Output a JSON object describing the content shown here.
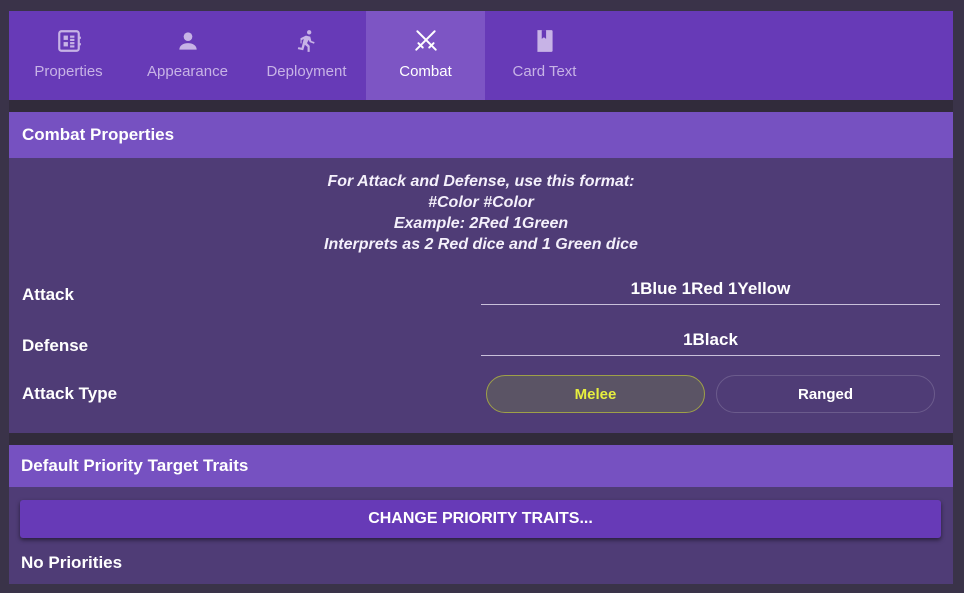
{
  "tabs": [
    {
      "label": "Properties",
      "icon": "properties-icon",
      "active": false
    },
    {
      "label": "Appearance",
      "icon": "person-icon",
      "active": false
    },
    {
      "label": "Deployment",
      "icon": "running-icon",
      "active": false
    },
    {
      "label": "Combat",
      "icon": "crossed-swords-icon",
      "active": true
    },
    {
      "label": "Card Text",
      "icon": "book-icon",
      "active": false
    }
  ],
  "combat": {
    "header": "Combat Properties",
    "instructions": [
      "For Attack and Defense, use this format:",
      "#Color #Color",
      "Example: 2Red 1Green",
      "Interprets as 2 Red dice and 1 Green dice"
    ],
    "attack_label": "Attack",
    "attack_value": "1Blue 1Red 1Yellow",
    "defense_label": "Defense",
    "defense_value": "1Black",
    "attack_type_label": "Attack Type",
    "attack_type_options": [
      "Melee",
      "Ranged"
    ],
    "attack_type_selected": "Melee"
  },
  "priority": {
    "header": "Default Priority Target Traits",
    "button_label": "CHANGE PRIORITY TRAITS...",
    "status": "No Priorities"
  },
  "colors": {
    "tab_bar": "#673ab7",
    "tab_active": "#7d55c4",
    "panel_header": "#7651c1",
    "panel_body": "#4f3c76",
    "selected_toggle_text": "#e6ef3e"
  }
}
